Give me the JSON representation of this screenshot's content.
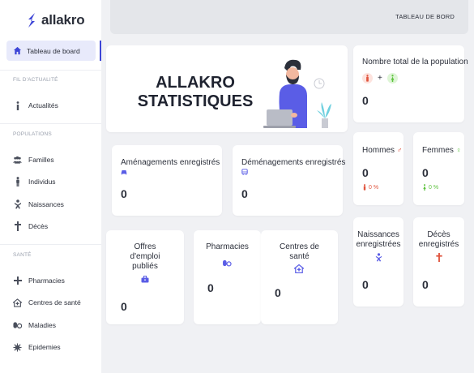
{
  "app": {
    "name": "allakro",
    "brand_color": "#3d45d6"
  },
  "header": {
    "title": "TABLEAU DE BORD"
  },
  "sidebar": {
    "active": {
      "label": "Tableau de board",
      "icon": "home-icon"
    },
    "sections": [
      {
        "title": "FIL D'ACTUALITÉ",
        "items": [
          {
            "label": "Actualités",
            "icon": "info-icon"
          }
        ]
      },
      {
        "title": "POPULATIONS",
        "items": [
          {
            "label": "Familles",
            "icon": "users-icon"
          },
          {
            "label": "Individus",
            "icon": "person-icon"
          },
          {
            "label": "Naissances",
            "icon": "baby-icon"
          },
          {
            "label": "Décès",
            "icon": "cross-icon"
          }
        ]
      },
      {
        "title": "SANTÉ",
        "items": [
          {
            "label": "Pharmacies",
            "icon": "plus-icon"
          },
          {
            "label": "Centres de santé",
            "icon": "clinic-icon"
          },
          {
            "label": "Maladies",
            "icon": "pills-icon"
          },
          {
            "label": "Epidemies",
            "icon": "virus-icon"
          }
        ]
      }
    ]
  },
  "hero": {
    "title_line1": "ALLAKRO",
    "title_line2": "STATISTIQUES"
  },
  "stats": {
    "population": {
      "title": "Nombre total de la population",
      "plus": "+",
      "value": "0"
    },
    "amenagements": {
      "title": "Aménagements enregistrés",
      "value": "0"
    },
    "demenagements": {
      "title": "Déménagements enregistrés",
      "value": "0"
    },
    "hommes": {
      "title": "Hommes",
      "value": "0",
      "pct": "0 %",
      "color": "#e0533d"
    },
    "femmes": {
      "title": "Femmes",
      "value": "0",
      "pct": "0 %",
      "color": "#5cc23d"
    },
    "offres": {
      "title_l1": "Offres",
      "title_l2": "d'emploi",
      "title_l3": "publiés",
      "value": "0"
    },
    "pharmacies": {
      "title": "Pharmacies",
      "value": "0"
    },
    "centres": {
      "title_l1": "Centres de",
      "title_l2": "santé",
      "value": "0"
    },
    "naissances": {
      "title_l1": "Naissances",
      "title_l2": "enregistrées",
      "value": "0"
    },
    "deces": {
      "title_l1": "Décès",
      "title_l2": "enregistrés",
      "value": "0"
    }
  }
}
